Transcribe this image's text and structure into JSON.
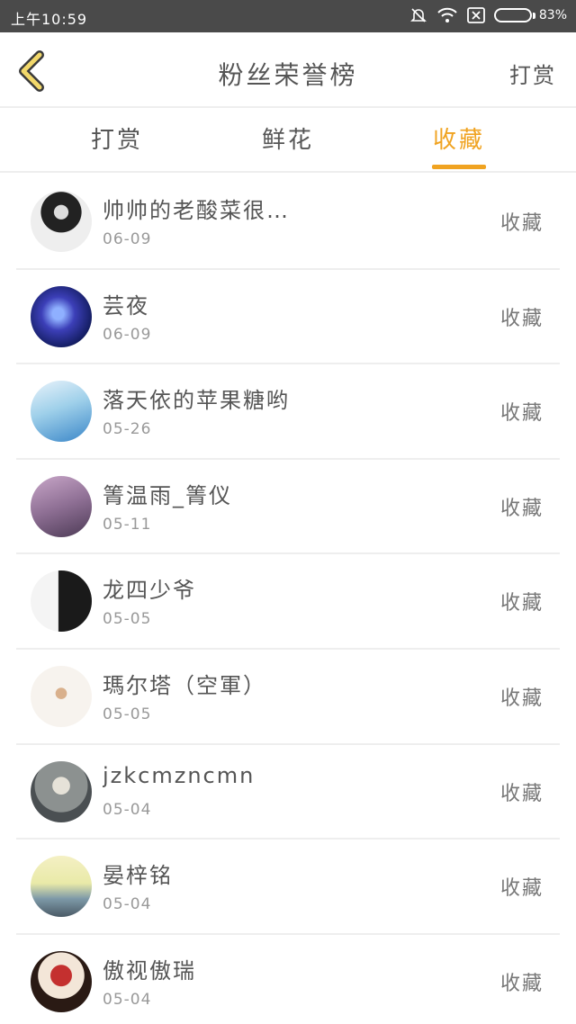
{
  "status_bar": {
    "time": "上午10:59",
    "battery_text": "83%",
    "battery_level": 0.83
  },
  "header": {
    "title": "粉丝荣誉榜",
    "action": "打赏",
    "back_icon": "chevron-left-icon"
  },
  "tabs": [
    {
      "label": "打赏",
      "active": false
    },
    {
      "label": "鲜花",
      "active": false
    },
    {
      "label": "收藏",
      "active": true
    }
  ],
  "colors": {
    "accent": "#f0a321",
    "divider": "#eeeeee",
    "status_bar": "#4a4a4a"
  },
  "fans": [
    {
      "name": "帅帅的老酸菜很…",
      "date": "06-09",
      "action": "收藏",
      "avatar": "dark-portrait"
    },
    {
      "name": "芸夜",
      "date": "06-09",
      "action": "收藏",
      "avatar": "blue-galaxy"
    },
    {
      "name": "落天依的苹果糖哟",
      "date": "05-26",
      "action": "收藏",
      "avatar": "anime-girl"
    },
    {
      "name": "箐温雨_箐仪",
      "date": "05-11",
      "action": "收藏",
      "avatar": "purple-girl"
    },
    {
      "name": "龙四少爷",
      "date": "05-05",
      "action": "收藏",
      "avatar": "black-white-boy"
    },
    {
      "name": "瑪尔塔（空軍）",
      "date": "05-05",
      "action": "收藏",
      "avatar": "paper-plane"
    },
    {
      "name": "jzkcmzncmn",
      "date": "05-04",
      "action": "收藏",
      "avatar": "grey-sketch"
    },
    {
      "name": "晏梓铭",
      "date": "05-04",
      "action": "收藏",
      "avatar": "pier-sunset"
    },
    {
      "name": "傲视傲瑞",
      "date": "05-04",
      "action": "收藏",
      "avatar": "cake"
    }
  ]
}
